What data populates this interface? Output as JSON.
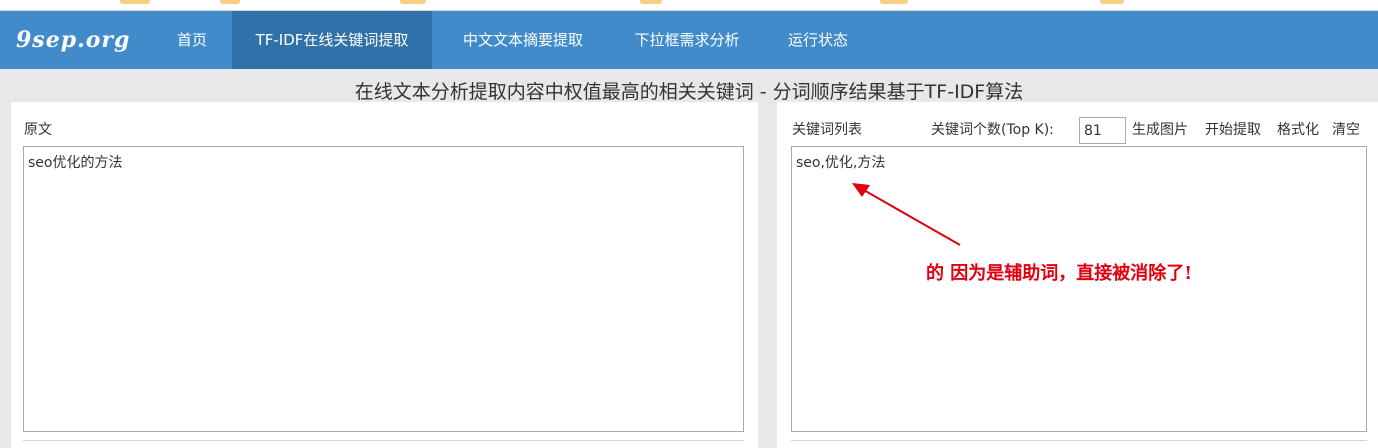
{
  "site": {
    "logo": "9sep.org"
  },
  "nav": {
    "items": [
      {
        "label": "首页"
      },
      {
        "label": "TF-IDF在线关键词提取"
      },
      {
        "label": "中文文本摘要提取"
      },
      {
        "label": "下拉框需求分析"
      },
      {
        "label": "运行状态"
      }
    ]
  },
  "heading": "在线文本分析提取内容中权值最高的相关关键词 - 分词顺序结果基于TF-IDF算法",
  "left_panel": {
    "label": "原文",
    "value": "seo优化的方法"
  },
  "right_panel": {
    "label": "关键词列表",
    "topk_label": "关键词个数(Top K):",
    "topk_value": "81",
    "buttons": {
      "generate_image": "生成图片",
      "start_extract": "开始提取",
      "format": "格式化",
      "clear": "清空"
    },
    "value": "seo,优化,方法"
  },
  "annotation": {
    "text": "的 因为是辅助词，直接被消除了!",
    "color": "#e0000f"
  },
  "colors": {
    "navbar": "#428bca",
    "nav_active": "#3071a9",
    "background": "#e8e8e8"
  }
}
